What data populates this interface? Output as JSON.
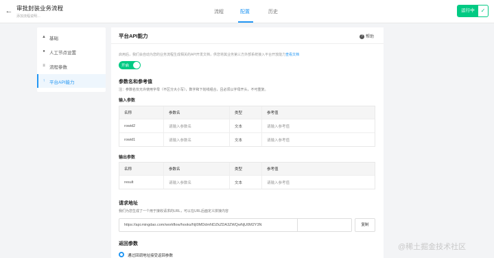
{
  "header": {
    "back_icon": "arrow-left-icon",
    "title": "审批封装业务流程",
    "subtitle": "添加流程说明…",
    "tabs": [
      {
        "label": "流程",
        "active": false
      },
      {
        "label": "配置",
        "active": true
      },
      {
        "label": "历史",
        "active": false
      }
    ],
    "run_button": {
      "label": "运行中",
      "icon": "check-icon",
      "color": "#01ca83"
    }
  },
  "sidebar": {
    "items": [
      {
        "label": "基础",
        "icon": "org-chart-icon",
        "active": false
      },
      {
        "label": "人工节点设置",
        "icon": "user-icon",
        "active": false
      },
      {
        "label": "流程参数",
        "icon": "params-icon",
        "active": false
      },
      {
        "label": "平台API能力",
        "icon": "upload-icon",
        "active": true
      }
    ]
  },
  "main": {
    "title": "平台API能力",
    "help_label": "帮助",
    "description": "启用后，我们会自动为您的业务流程生成相关的API开发文档，供您将其业务第三方外部系统接入平台开放能力",
    "description_link": "查看文档",
    "toggle": {
      "label": "开启",
      "on": true
    },
    "params_section": {
      "title": "参数名和参考值",
      "note": "注：参数名仅允许使用字母（不区分大小写），数字和下划线组合，且必须以字母开头，不可重复。"
    },
    "input_params": {
      "title": "输入参数",
      "columns": [
        "名称",
        "参数名",
        "类型",
        "参考值"
      ],
      "rows": [
        {
          "name": "rowid2",
          "param_placeholder": "请输入参数名",
          "type": "文本",
          "ref_placeholder": "请输入参考值"
        },
        {
          "name": "rowid1",
          "param_placeholder": "请输入参数名",
          "type": "文本",
          "ref_placeholder": "请输入参考值"
        }
      ]
    },
    "output_params": {
      "title": "输出参数",
      "columns": [
        "名称",
        "参数名",
        "类型",
        "参考值"
      ],
      "rows": [
        {
          "name": "result",
          "param_placeholder": "请输入参数名",
          "type": "文本",
          "ref_placeholder": "请输入参考值"
        }
      ]
    },
    "request_url": {
      "title": "请求地址",
      "note": "我们为您生成了一个用于接收请求的URL，可以在URL后面定义拼接内容",
      "url": "https://api.mingdao.com/workflow/hooks/NjI0MDdmNDZkZDA3ZWQwNjU0M2Y3N",
      "copy_label": "复制"
    },
    "return_params": {
      "title": "返回参数",
      "option_label": "通过回调地址接受返回参数"
    }
  },
  "watermark": "@稀土掘金技术社区"
}
